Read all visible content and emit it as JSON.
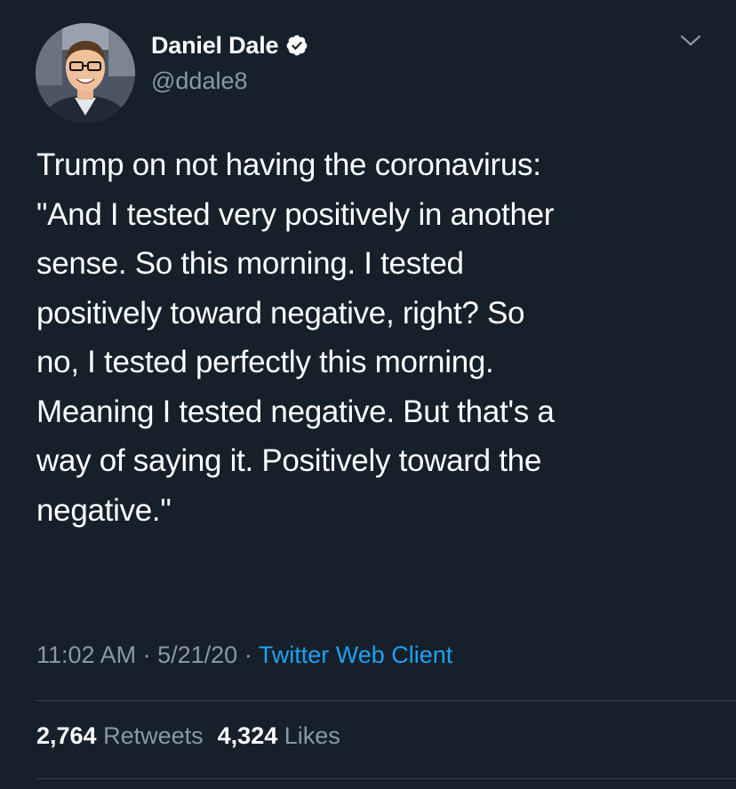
{
  "author": {
    "display_name": "Daniel Dale",
    "handle": "@ddale8",
    "verified": true
  },
  "tweet": {
    "text": "Trump on not having the coronavirus:\n\"And I tested very positively in another\nsense. So this morning. I tested\npositively toward negative, right? So\nno, I tested perfectly this morning.\nMeaning I tested negative. But that's a\nway of saying it. Positively toward the\nnegative.\"",
    "time": "11:02 AM",
    "date": "5/21/20",
    "separator": "·",
    "source": "Twitter Web Client"
  },
  "stats": {
    "retweets_count": "2,764",
    "retweets_label": "Retweets",
    "likes_count": "4,324",
    "likes_label": "Likes"
  },
  "icons": {
    "verified": "verified-badge-icon",
    "menu": "chevron-down-icon"
  },
  "colors": {
    "background": "#15202b",
    "primary_text": "#ffffff",
    "secondary_text": "#8899a6",
    "accent": "#1da1f2",
    "divider": "#38444d"
  }
}
